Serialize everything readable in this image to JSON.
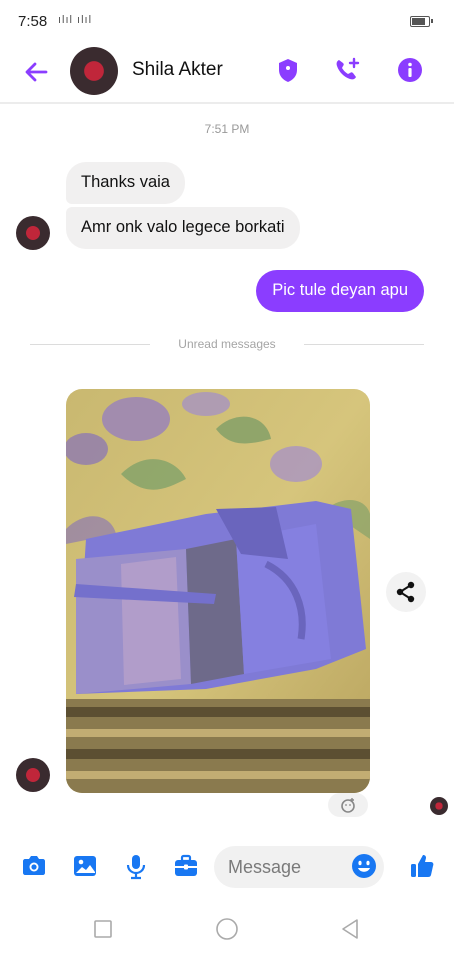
{
  "status_bar": {
    "time": "7:58",
    "signal": "ılıl ılıl",
    "battery_level": 0.85
  },
  "header": {
    "contact_name": "Shila Akter",
    "icons": [
      "back-arrow-icon",
      "shield-icon",
      "phone-plus-icon",
      "info-icon"
    ]
  },
  "chat": {
    "timestamp": "7:51 PM",
    "incoming_messages": [
      "Thanks vaia",
      "Amr onk valo legece borkati"
    ],
    "outgoing_message": "Pic tule deyan apu",
    "unread_divider": "Unread messages"
  },
  "composer": {
    "placeholder": "Message",
    "icons": [
      "camera-icon",
      "gallery-icon",
      "microphone-icon",
      "briefcase-icon",
      "emoji-icon",
      "thumbs-up-icon"
    ]
  },
  "colors": {
    "accent": "#8b3dff",
    "composer_blue": "#1877f2",
    "bubble_in": "#f1f0f0"
  }
}
